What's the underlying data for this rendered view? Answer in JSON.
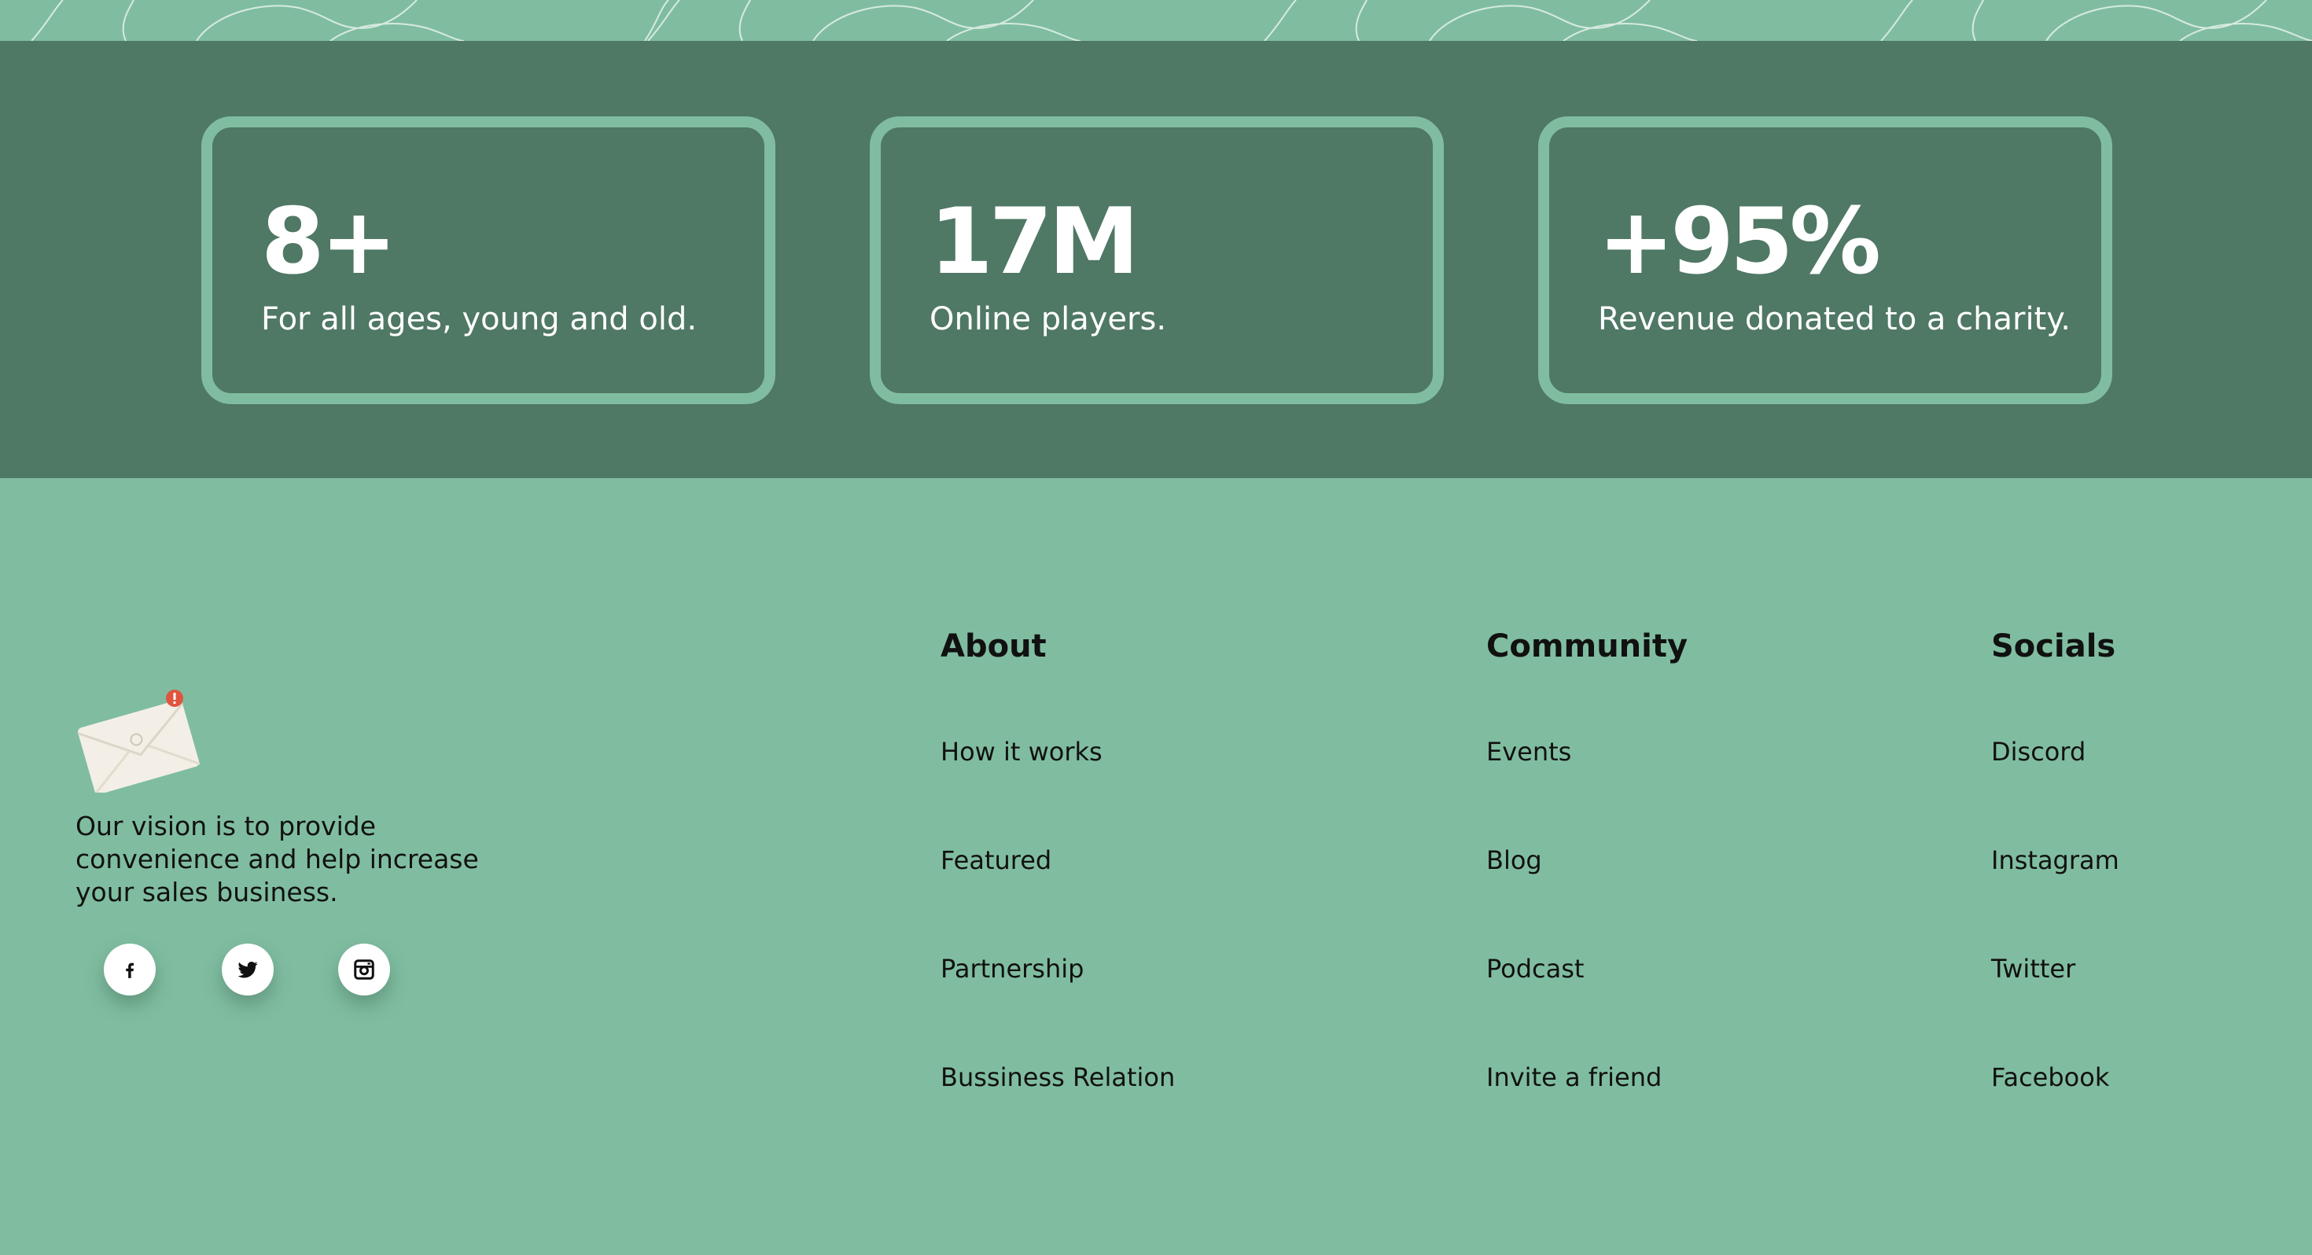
{
  "stats": [
    {
      "value": "8+",
      "description": "For all ages, young and old."
    },
    {
      "value": "17M",
      "description": "Online players."
    },
    {
      "value": "+95%",
      "description": "Revenue donated to a charity."
    }
  ],
  "footer": {
    "brand_icon": "envelope-notification-icon",
    "vision_text": "Our vision is to provide convenience and help increase your sales business.",
    "social_icons": [
      "facebook-icon",
      "twitter-icon",
      "instagram-icon"
    ],
    "columns": [
      {
        "title": "About",
        "links": [
          "How it works",
          "Featured",
          "Partnership",
          "Bussiness Relation"
        ]
      },
      {
        "title": "Community",
        "links": [
          "Events",
          "Blog",
          "Podcast",
          "Invite a friend"
        ]
      },
      {
        "title": "Socials",
        "links": [
          "Discord",
          "Instagram",
          "Twitter",
          "Facebook"
        ]
      }
    ]
  },
  "colors": {
    "page_bg": "#80bda0",
    "stats_band_bg": "#4f7865",
    "card_border": "#80bda0",
    "text_light": "#ffffff",
    "text_dark": "#111111"
  }
}
